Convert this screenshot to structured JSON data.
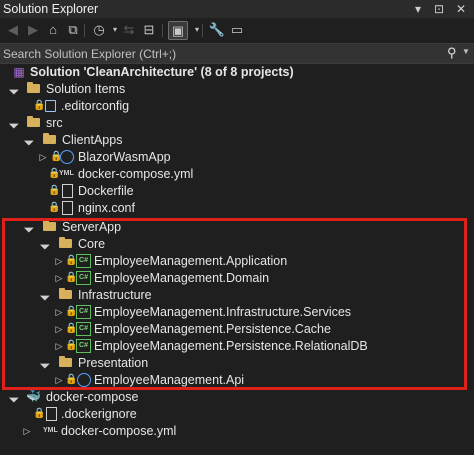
{
  "window": {
    "title": "Solution Explorer",
    "controls": [
      "▾",
      "⊡",
      "✕"
    ]
  },
  "toolbar": {
    "buttons": [
      {
        "name": "back",
        "glyph": "◀"
      },
      {
        "name": "forward",
        "glyph": "▶"
      },
      {
        "name": "home",
        "glyph": "⌂"
      },
      {
        "name": "switch-views",
        "glyph": "⧉"
      },
      {
        "name": "pending-changes",
        "glyph": "◷"
      },
      {
        "name": "sync",
        "glyph": "⇆"
      },
      {
        "name": "collapse-all",
        "glyph": "⊟"
      },
      {
        "name": "show-all-files",
        "glyph": "▣"
      },
      {
        "name": "properties",
        "glyph": "🔧"
      },
      {
        "name": "preview",
        "glyph": "▭"
      }
    ]
  },
  "search": {
    "placeholder": "Search Solution Explorer (Ctrl+;)"
  },
  "tree": {
    "solution": "Solution 'CleanArchitecture' (8 of 8 projects)",
    "solution_items": "Solution Items",
    "editorconfig": ".editorconfig",
    "src": "src",
    "clientapps": "ClientApps",
    "blazorwasmapp": "BlazorWasmApp",
    "docker_compose_client": "docker-compose.yml",
    "dockerfile": "Dockerfile",
    "nginx": "nginx.conf",
    "serverapp": "ServerApp",
    "core": "Core",
    "application": "EmployeeManagement.Application",
    "domain": "EmployeeManagement.Domain",
    "infrastructure": "Infrastructure",
    "infra_services": "EmployeeManagement.Infrastructure.Services",
    "persistence_cache": "EmployeeManagement.Persistence.Cache",
    "persistence_rel": "EmployeeManagement.Persistence.RelationalDB",
    "presentation": "Presentation",
    "api": "EmployeeManagement.Api",
    "docker_compose_proj": "docker-compose",
    "dockerignore": ".dockerignore",
    "docker_compose_root": "docker-compose.yml"
  },
  "icon_labels": {
    "csharp": "C#",
    "yml": "YML"
  },
  "colors": {
    "highlight_border": "#e0211b",
    "folder": "#d6b05a",
    "csharp": "#5fbf5f",
    "background": "#1f1f1f"
  }
}
